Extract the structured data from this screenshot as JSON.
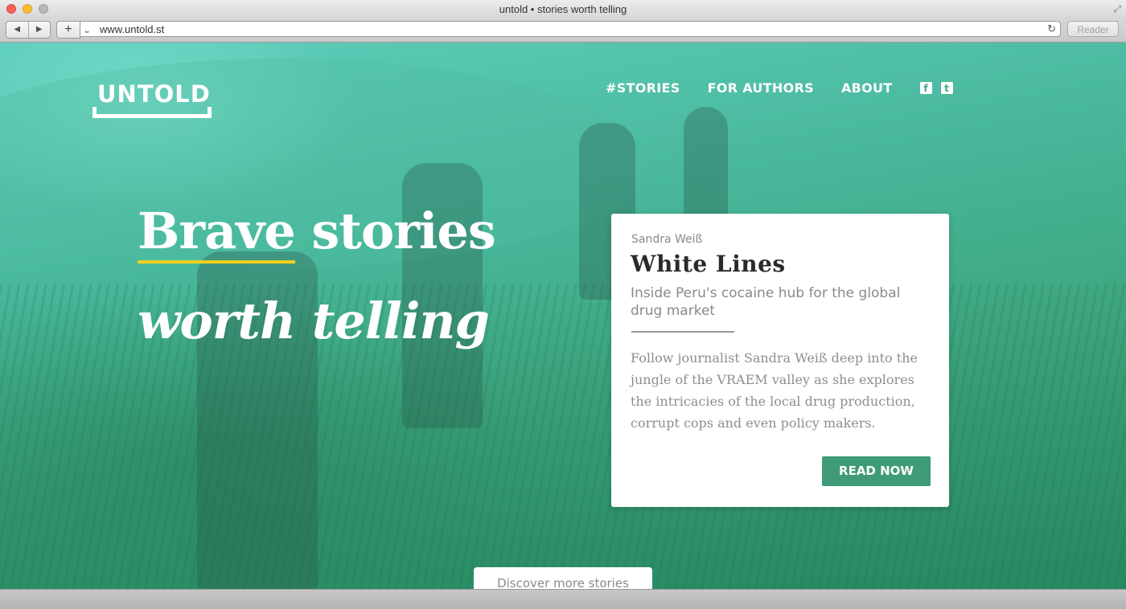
{
  "window": {
    "title": "untold • stories worth telling"
  },
  "toolbar": {
    "back_icon": "back-arrow-icon",
    "forward_icon": "forward-arrow-icon",
    "add_label": "+",
    "url": "www.untold.st",
    "reader_label": "Reader"
  },
  "site": {
    "logo_text": "UNTOLD",
    "nav": [
      {
        "label": "#STORIES"
      },
      {
        "label": "FOR AUTHORS"
      },
      {
        "label": "ABOUT"
      }
    ],
    "social": {
      "facebook_glyph": "f",
      "twitter_glyph": "t"
    }
  },
  "hero": {
    "line1_word1": "Brave",
    "line1_word2": "stories",
    "line2": "worth telling",
    "accent_color": "#f2d11e"
  },
  "story_card": {
    "author": "Sandra Weiß",
    "title": "White Lines",
    "subtitle": "Inside Peru's cocaine hub for the global drug market",
    "body": "Follow journalist Sandra Weiß deep into the jungle of the VRAEM valley as she explores the intricacies of the local drug production, corrupt cops and even policy makers.",
    "cta_label": "READ NOW",
    "cta_color": "#3f9a77"
  },
  "discover": {
    "label": "Discover more stories"
  }
}
